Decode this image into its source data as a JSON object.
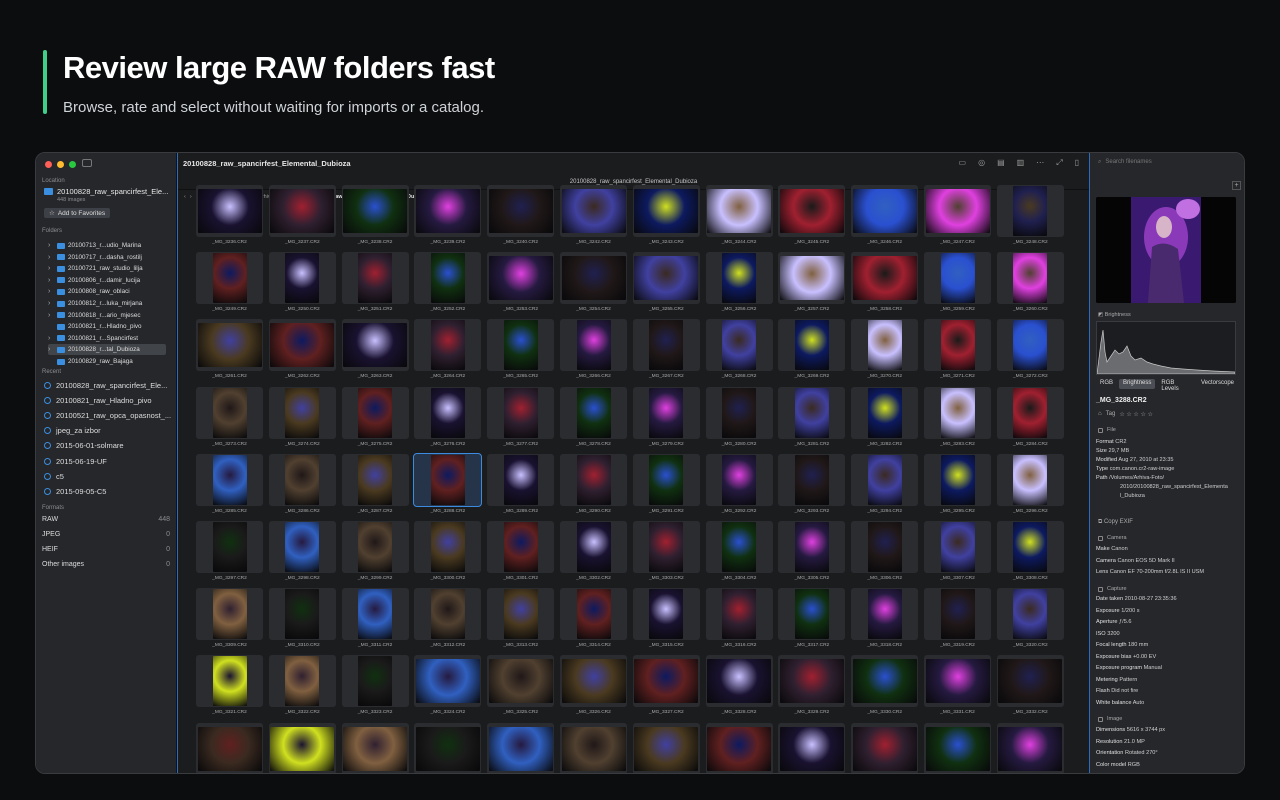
{
  "hero": {
    "title": "Review large RAW folders fast",
    "subtitle": "Browse, rate and select without waiting for imports or a catalog."
  },
  "window": {
    "title": "20100828_raw_spancirfest_Elemental_Dubioza",
    "tab_title": "20100828_raw_spancirfest_Elemental_Dubioza"
  },
  "breadcrumb": [
    "Macintosh HD",
    "Volumes",
    "Arhiva-Foto",
    "2010",
    "20100828_raw_spancirfest_Elemental_Dubioza"
  ],
  "sidebar": {
    "location_label": "Location",
    "location_name": "20100828_raw_spancirfest_Ele...",
    "location_count": "448 images",
    "favorites_button": "Add to Favorites",
    "folders_label": "Folders",
    "folders": [
      {
        "label": "20100713_r...udio_Marina",
        "chev": "›"
      },
      {
        "label": "20100717_r...dasha_rostilj",
        "chev": "›"
      },
      {
        "label": "20100721_raw_studio_lilja",
        "chev": "›"
      },
      {
        "label": "20100806_r...damir_lucija",
        "chev": "›"
      },
      {
        "label": "20100808_raw_oblaci",
        "chev": "›"
      },
      {
        "label": "20100812_r...luka_mirjana",
        "chev": "›"
      },
      {
        "label": "20100818_r...ario_mjesec",
        "chev": "›"
      },
      {
        "label": "20100821_r...Hladno_pivo",
        "chev": ""
      },
      {
        "label": "20100821_r...Spancirfest",
        "chev": "›"
      },
      {
        "label": "20100828_r...tal_Dubioza",
        "chev": "›"
      },
      {
        "label": "20100829_raw_Bajaga",
        "chev": ""
      }
    ],
    "recent_label": "Recent",
    "recent": [
      "20100828_raw_spancirfest_Ele...",
      "20100821_raw_Hladno_pivo",
      "20100521_raw_opca_opasnost_...",
      "jpeg_za izbor",
      "2015-06-01-solmare",
      "2015-06-19-UF",
      "c5",
      "2015-09-05-C5"
    ],
    "formats_label": "Formats",
    "formats": [
      {
        "name": "RAW",
        "count": "448"
      },
      {
        "name": "JPEG",
        "count": "0"
      },
      {
        "name": "HEIF",
        "count": "0"
      },
      {
        "name": "Other images",
        "count": "0"
      }
    ]
  },
  "search": {
    "placeholder": "Search filenames"
  },
  "thumbnails": [
    [
      "_MG_3236.CR2",
      "_MG_3237.CR2",
      "_MG_3238.CR2",
      "_MG_3239.CR2",
      "_MG_3240.CR2",
      "_MG_3242.CR2",
      "_MG_3243.CR2",
      "_MG_3244.CR2",
      "_MG_3245.CR2",
      "_MG_3246.CR2",
      "_MG_3247.CR2",
      "_MG_3248.CR2"
    ],
    [
      "_MG_3249.CR2",
      "_MG_3250.CR2",
      "_MG_3251.CR2",
      "_MG_3252.CR2",
      "_MG_3253.CR2",
      "_MG_3254.CR2",
      "_MG_3255.CR2",
      "_MG_3256.CR2",
      "_MG_3257.CR2",
      "_MG_3258.CR2",
      "_MG_3259.CR2",
      "_MG_3260.CR2"
    ],
    [
      "_MG_3261.CR2",
      "_MG_3262.CR2",
      "_MG_3263.CR2",
      "_MG_3264.CR2",
      "_MG_3265.CR2",
      "_MG_3266.CR2",
      "_MG_3267.CR2",
      "_MG_3268.CR2",
      "_MG_3269.CR2",
      "_MG_3270.CR2",
      "_MG_3271.CR2",
      "_MG_3272.CR2"
    ],
    [
      "_MG_3273.CR2",
      "_MG_3274.CR2",
      "_MG_3275.CR2",
      "_MG_3276.CR2",
      "_MG_3277.CR2",
      "_MG_3278.CR2",
      "_MG_3279.CR2",
      "_MG_3280.CR2",
      "_MG_3281.CR2",
      "_MG_3282.CR2",
      "_MG_3283.CR2",
      "_MG_3284.CR2"
    ],
    [
      "_MG_3285.CR2",
      "_MG_3286.CR2",
      "_MG_3287.CR2",
      "_MG_3288.CR2",
      "_MG_3289.CR2",
      "_MG_3290.CR2",
      "_MG_3291.CR2",
      "_MG_3292.CR2",
      "_MG_3293.CR2",
      "_MG_3294.CR2",
      "_MG_3295.CR2",
      "_MG_3296.CR2"
    ],
    [
      "_MG_3297.CR2",
      "_MG_3298.CR2",
      "_MG_3299.CR2",
      "_MG_3300.CR2",
      "_MG_3301.CR2",
      "_MG_3302.CR2",
      "_MG_3303.CR2",
      "_MG_3304.CR2",
      "_MG_3305.CR2",
      "_MG_3306.CR2",
      "_MG_3307.CR2",
      "_MG_3308.CR2"
    ],
    [
      "_MG_3309.CR2",
      "_MG_3310.CR2",
      "_MG_3311.CR2",
      "_MG_3312.CR2",
      "_MG_3313.CR2",
      "_MG_3314.CR2",
      "_MG_3315.CR2",
      "_MG_3316.CR2",
      "_MG_3317.CR2",
      "_MG_3318.CR2",
      "_MG_3319.CR2",
      "_MG_3320.CR2"
    ],
    [
      "_MG_3321.CR2",
      "_MG_3322.CR2",
      "_MG_3323.CR2",
      "_MG_3324.CR2",
      "_MG_3325.CR2",
      "_MG_3326.CR2",
      "_MG_3327.CR2",
      "_MG_3328.CR2",
      "_MG_3329.CR2",
      "_MG_3330.CR2",
      "_MG_3331.CR2",
      "_MG_3332.CR2"
    ],
    [
      "",
      "",
      "",
      "",
      "",
      "",
      "",
      "",
      "",
      "",
      "",
      ""
    ]
  ],
  "selected_thumbnail": "_MG_3288.CR2",
  "inspector": {
    "brightness_label": "Brightness",
    "tabs": [
      "RGB",
      "Brightness",
      "RGB Levels",
      "Vectorscope"
    ],
    "file_name": "_MG_3288.CR2",
    "tag_label": "Tag",
    "stars": "☆ ☆ ☆ ☆ ☆",
    "file_section": "File",
    "file": [
      [
        "Format",
        "CR2"
      ],
      [
        "Size",
        "29,7 MB"
      ],
      [
        "Modified",
        "Aug 27, 2010 at 23:35"
      ],
      [
        "Type",
        "com.canon.cr2-raw-image"
      ],
      [
        "Path",
        "/Volumes/Arhiva-Foto/"
      ],
      [
        "",
        "2010/20100828_raw_spancirfest_Elementa"
      ],
      [
        "",
        "l_Dubioza"
      ]
    ],
    "copy_exif": "Copy EXIF",
    "camera_section": "Camera",
    "camera": [
      [
        "Make",
        "Canon"
      ],
      [
        "Camera",
        "Canon EOS 5D Mark II"
      ],
      [
        "Lens",
        "Canon EF 70-200mm f/2.8L IS II USM"
      ]
    ],
    "capture_section": "Capture",
    "capture": [
      [
        "Date taken",
        "2010-08-27 23:35:36"
      ],
      [
        "Exposure",
        "1/200 s"
      ],
      [
        "Aperture",
        "ƒ/5.6"
      ],
      [
        "ISO",
        "3200"
      ],
      [
        "Focal length",
        "180 mm"
      ],
      [
        "Exposure bias",
        "+0.00 EV"
      ],
      [
        "Exposure program",
        "Manual"
      ],
      [
        "Metering",
        "Pattern"
      ],
      [
        "Flash",
        "Did not fire"
      ],
      [
        "White balance",
        "Auto"
      ]
    ],
    "image_section": "Image",
    "image": [
      [
        "Dimensions",
        "5616 x 3744 px"
      ],
      [
        "Resolution",
        "21.0 MP"
      ],
      [
        "Orientation",
        "Rotated 270°"
      ],
      [
        "Color model",
        "RGB"
      ]
    ]
  }
}
